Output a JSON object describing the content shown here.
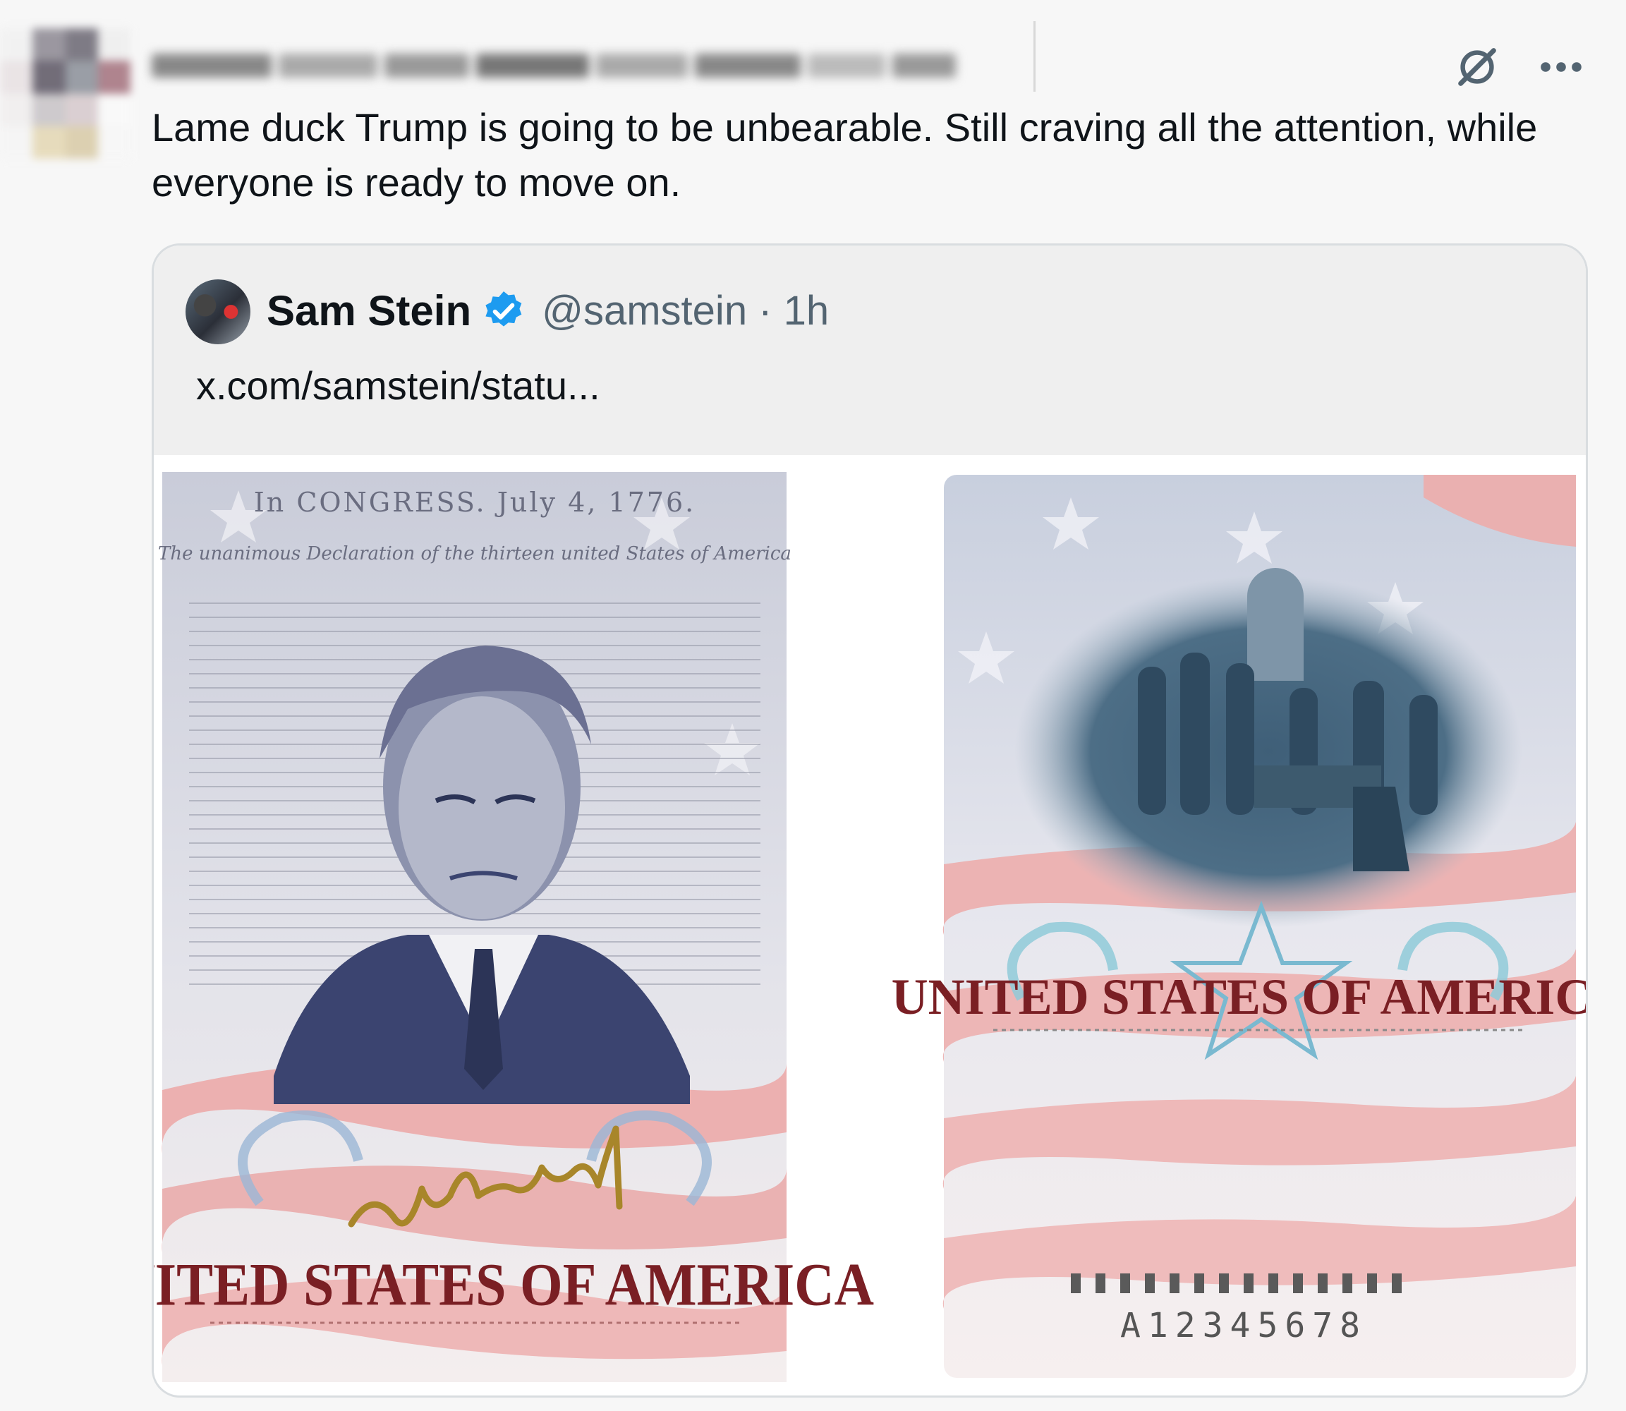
{
  "post": {
    "text": "Lame duck Trump is going to be unbearable. Still craving all the attention, while everyone is ready to move on."
  },
  "quote": {
    "author_name": "Sam Stein",
    "handle_time": "@samstein · 1h",
    "link": "x.com/samstein/statu..."
  },
  "media": {
    "left": {
      "header": "In CONGRESS. July 4, 1776.",
      "declaration": "The unanimous Declaration of the thirteen united States of America",
      "country": "UNITED STATES OF AMERICA"
    },
    "right": {
      "country": "UNITED STATES OF AMERICA",
      "number": "A12345678"
    }
  },
  "colors": {
    "verified": "#1d9bf0",
    "flag_red": "#e8a4a4",
    "engraving_blue": "#4a5780",
    "country_red": "#7a1f24",
    "signature_gold": "#a8862a"
  },
  "icons": {
    "grok": "grok-icon",
    "more": "more-icon",
    "verified": "verified-badge-icon"
  }
}
